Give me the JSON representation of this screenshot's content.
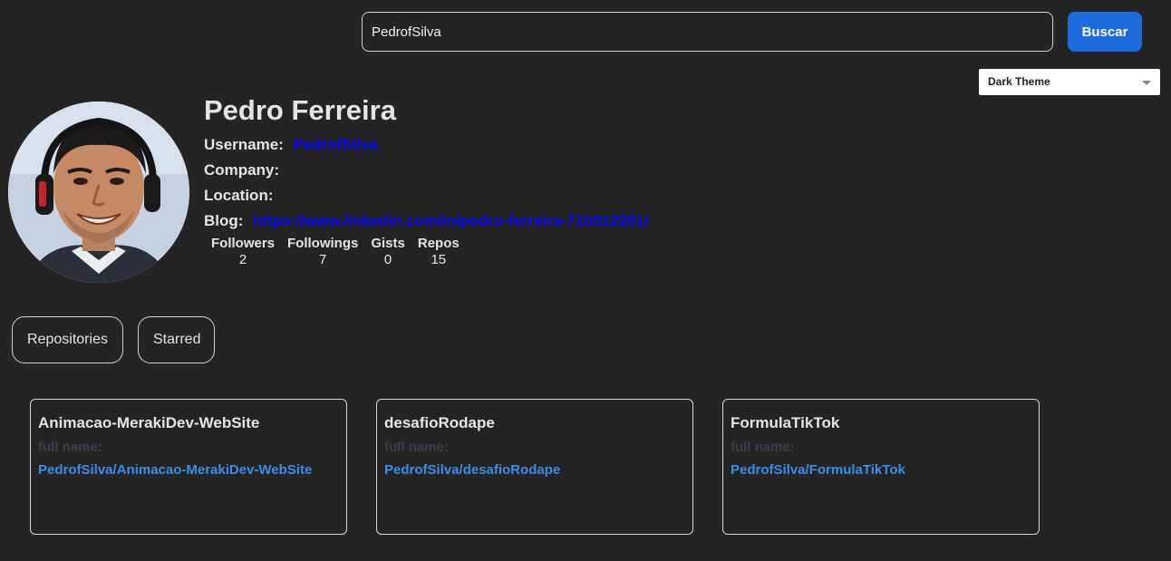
{
  "search": {
    "value": "PedrofSilva",
    "button_label": "Buscar"
  },
  "theme_select": {
    "selected": "Dark Theme"
  },
  "profile": {
    "name": "Pedro Ferreira",
    "username_label": "Username:",
    "username_value": "PedrofSilva",
    "company_label": "Company:",
    "company_value": "",
    "location_label": "Location:",
    "location_value": "",
    "blog_label": "Blog:",
    "blog_value": "https://www.linkedin.com/in/pedro-ferreira-71b912201/"
  },
  "stats": [
    {
      "label": "Followers",
      "value": "2"
    },
    {
      "label": "Followings",
      "value": "7"
    },
    {
      "label": "Gists",
      "value": "0"
    },
    {
      "label": "Repos",
      "value": "15"
    }
  ],
  "tabs": {
    "repositories": "Repositories",
    "starred": "Starred"
  },
  "repos": [
    {
      "name": "Animacao-MerakiDev-WebSite",
      "full_name_label": "full name:",
      "link": "PedrofSilva/Animacao-MerakiDev-WebSite"
    },
    {
      "name": "desafioRodape",
      "full_name_label": "full name:",
      "link": "PedrofSilva/desafioRodape"
    },
    {
      "name": "FormulaTikTok",
      "full_name_label": "full name:",
      "link": "PedrofSilva/FormulaTikTok"
    }
  ]
}
